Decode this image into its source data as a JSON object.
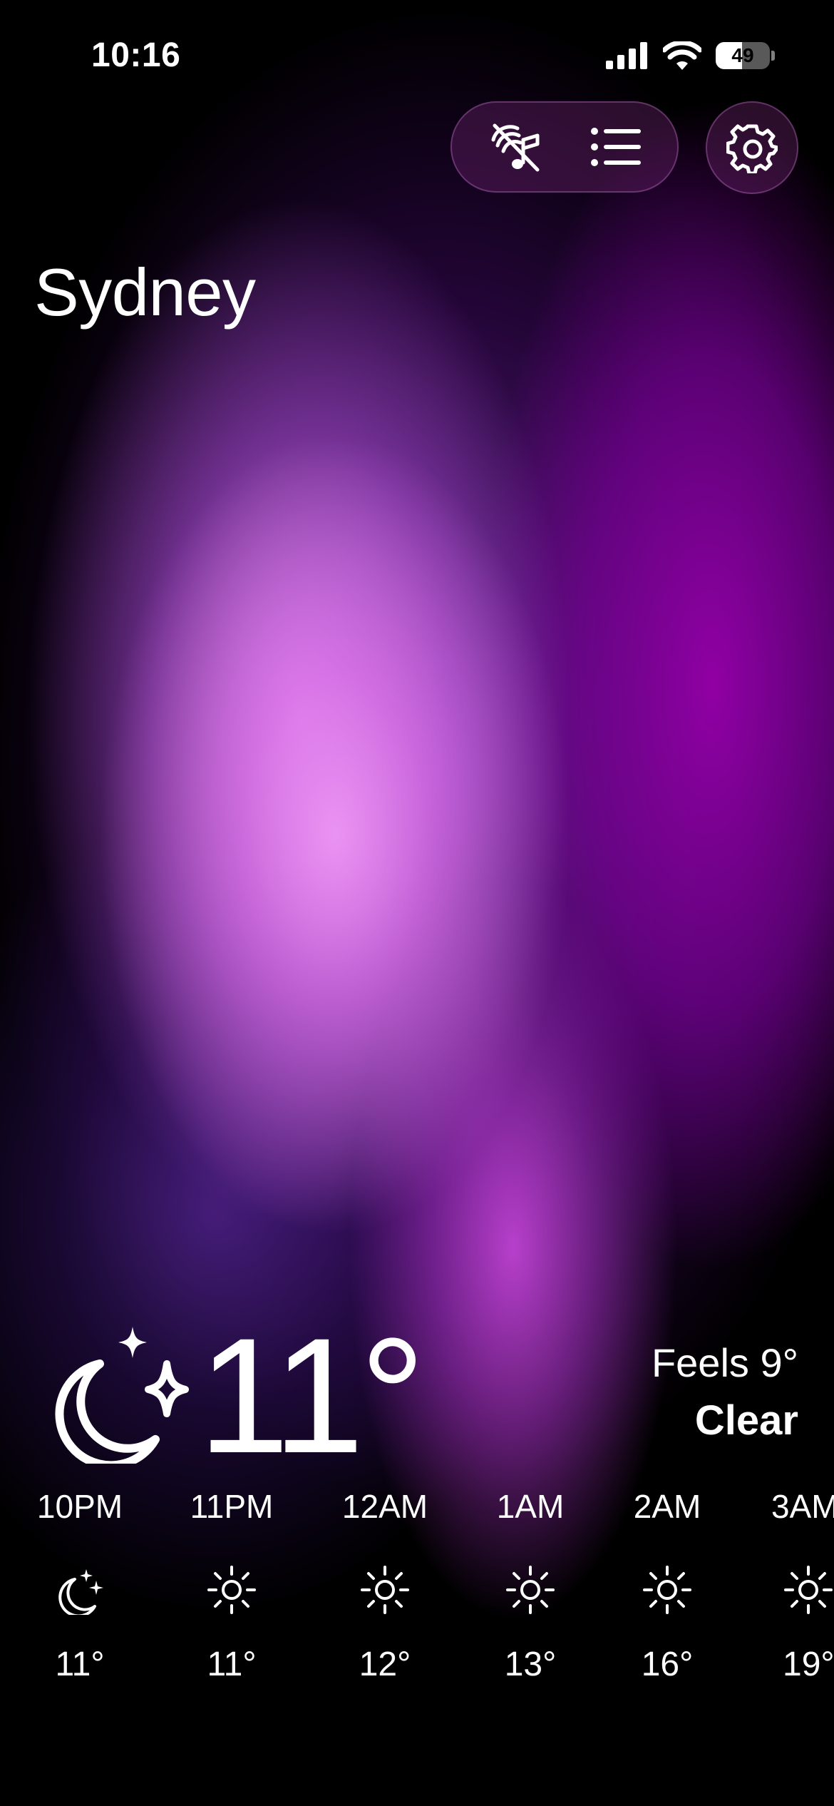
{
  "status_bar": {
    "time": "10:16",
    "battery_level": "49"
  },
  "toolbar": {
    "sound_toggle_icon": "music-note-slash-icon",
    "list_icon": "list-icon",
    "settings_icon": "gear-icon"
  },
  "location": {
    "city": "Sydney"
  },
  "current": {
    "icon": "moon-stars-icon",
    "temperature": "11°",
    "feels_like": "Feels 9°",
    "condition": "Clear"
  },
  "hourly": [
    {
      "time": "10PM",
      "icon": "moon-stars-icon",
      "temp": "11°"
    },
    {
      "time": "11PM",
      "icon": "sun-icon",
      "temp": "11°"
    },
    {
      "time": "12AM",
      "icon": "sun-icon",
      "temp": "12°"
    },
    {
      "time": "1AM",
      "icon": "sun-icon",
      "temp": "13°"
    },
    {
      "time": "2AM",
      "icon": "sun-icon",
      "temp": "16°"
    },
    {
      "time": "3AM",
      "icon": "sun-icon",
      "temp": "19°"
    }
  ]
}
